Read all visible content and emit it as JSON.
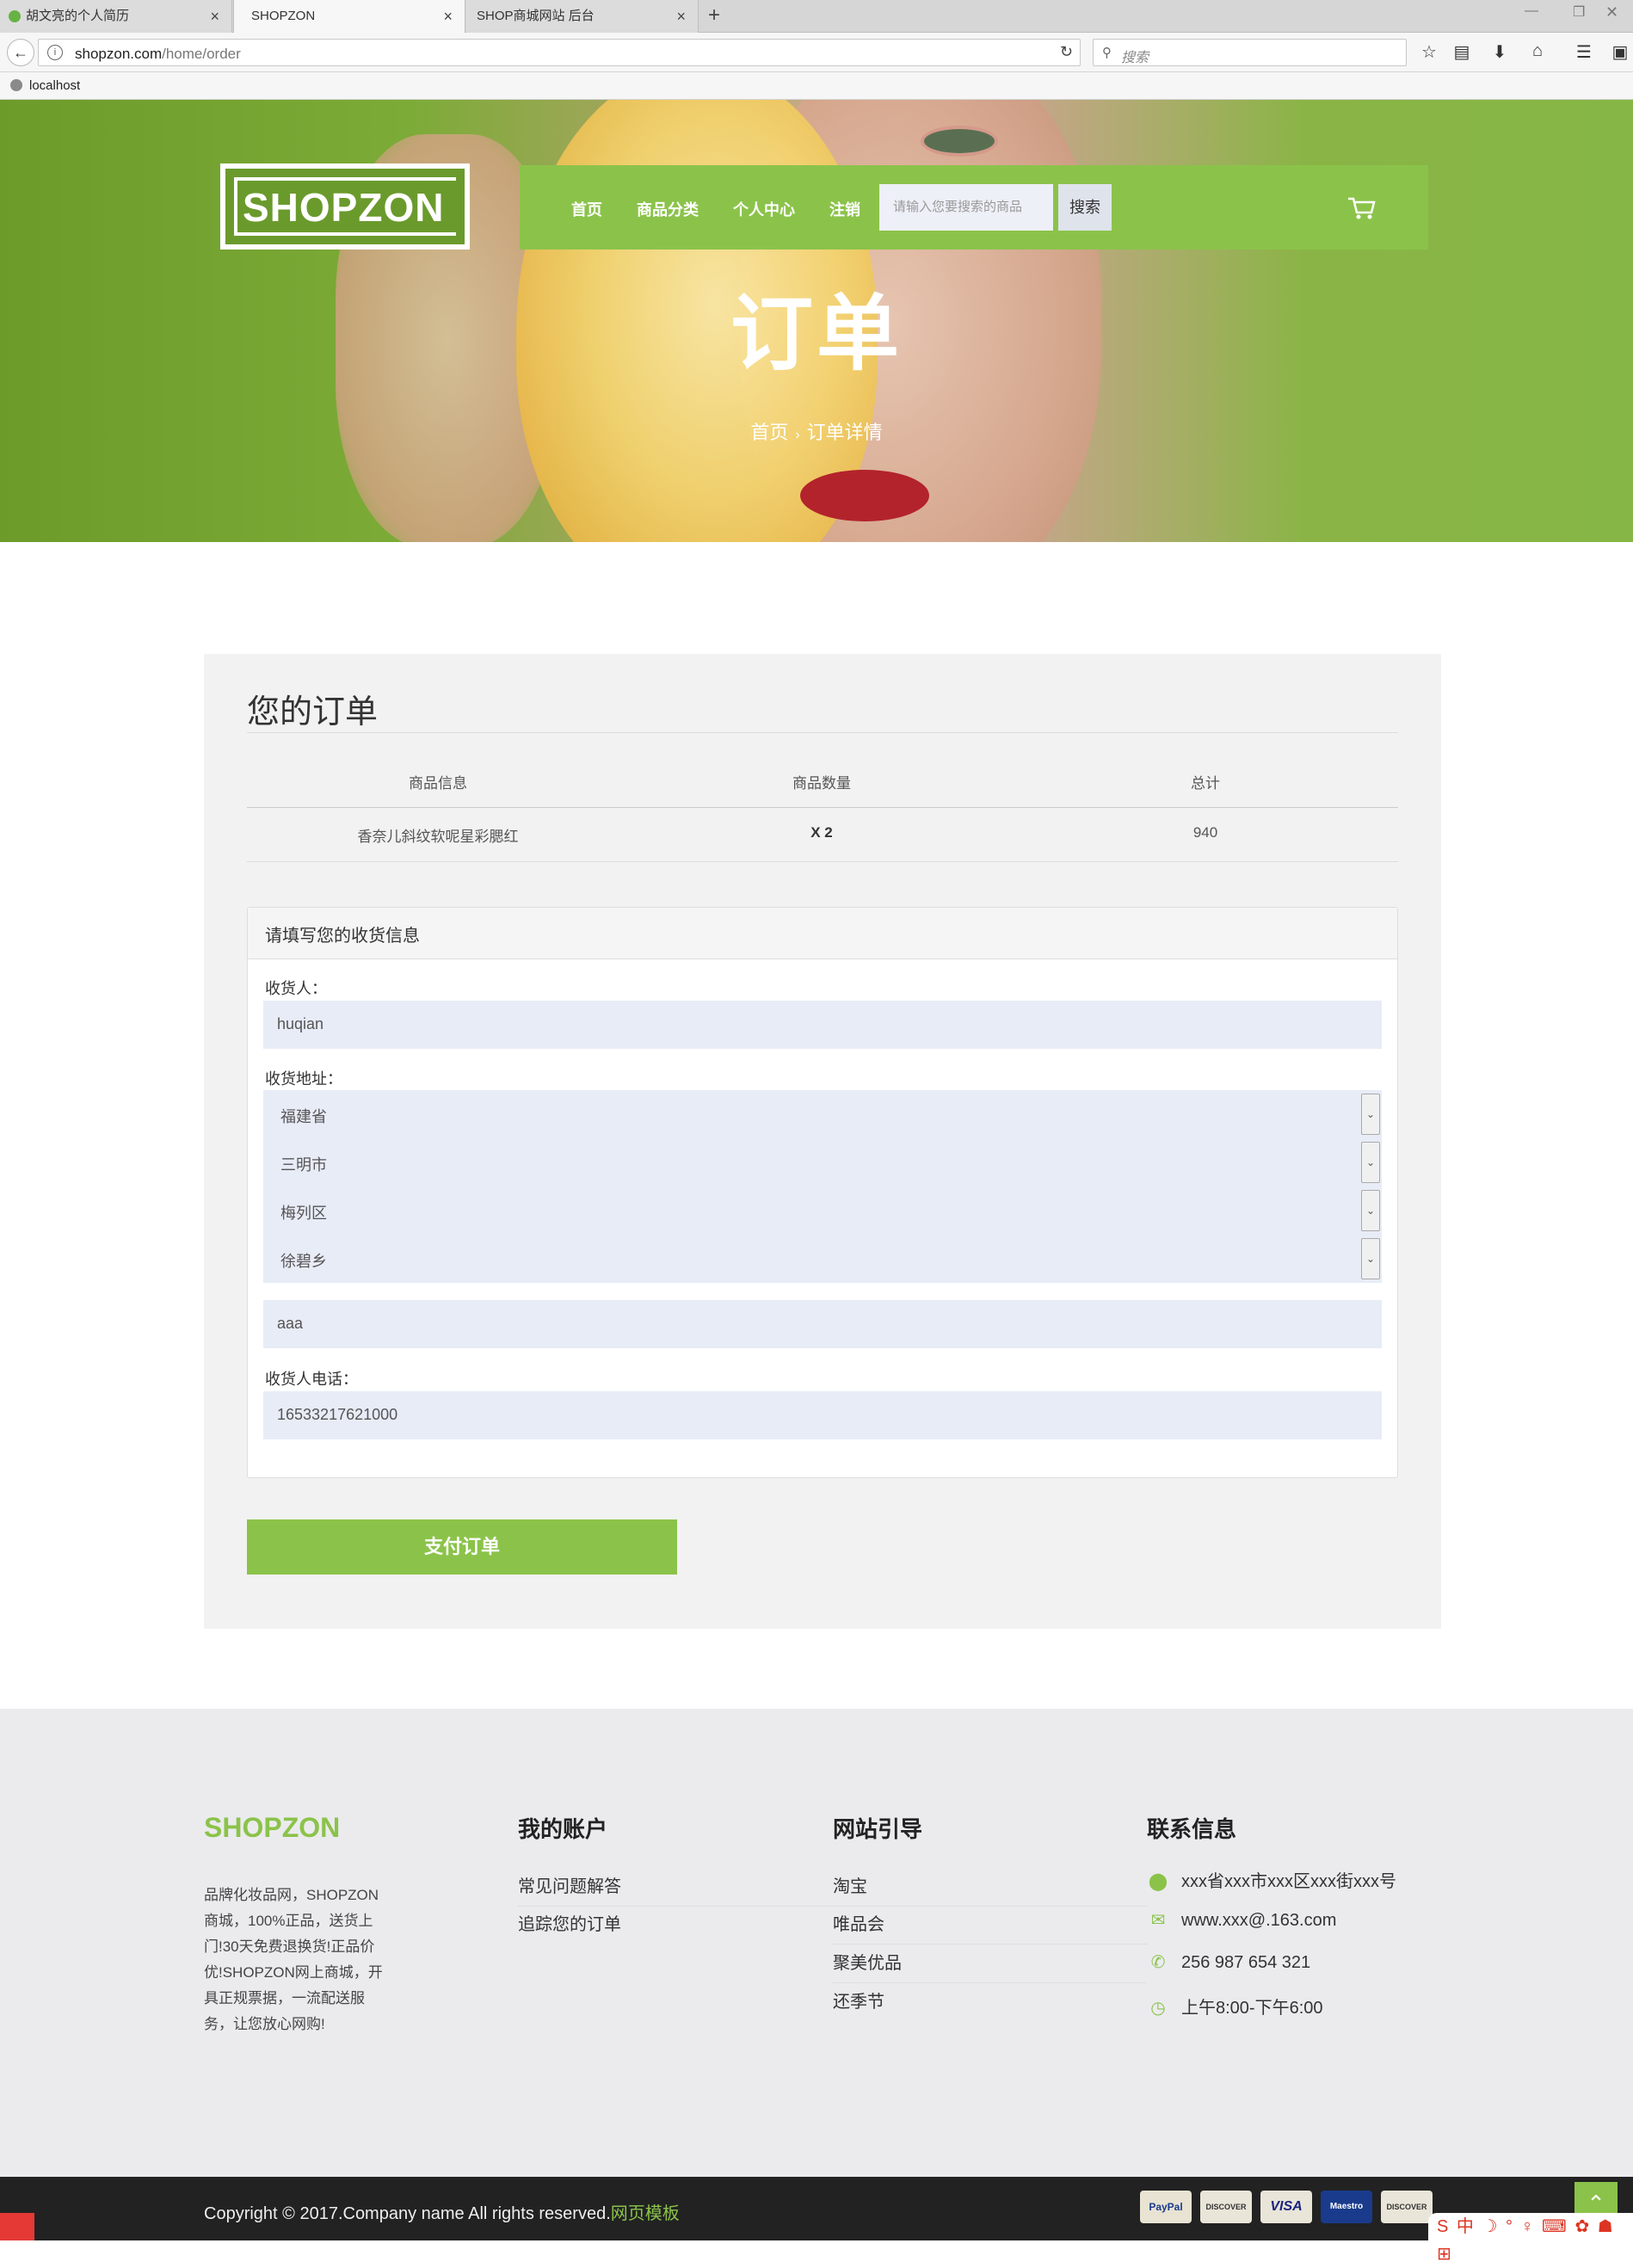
{
  "browser": {
    "tabs": [
      {
        "label": "胡文亮的个人简历"
      },
      {
        "label": "SHOPZON"
      },
      {
        "label": "SHOP商城网站 后台"
      }
    ],
    "url_host": "shopzon.com",
    "url_path": "/home/order",
    "search_placeholder": "搜索",
    "bookmark": "localhost"
  },
  "site": {
    "logo": "SHOPZON",
    "nav": {
      "home": "首页",
      "categories": "商品分类",
      "account": "个人中心",
      "logout": "注销",
      "search_placeholder": "请输入您要搜索的商品",
      "search_button": "搜索"
    },
    "hero_title": "订单",
    "breadcrumb": {
      "home": "首页",
      "current": "订单详情"
    }
  },
  "order": {
    "title": "您的订单",
    "headers": {
      "info": "商品信息",
      "qty": "商品数量",
      "total": "总计"
    },
    "row": {
      "name": "香奈儿斜纹软呢星彩腮红",
      "qty": "X 2",
      "total": "940"
    },
    "shipping": {
      "heading": "请填写您的收货信息",
      "receiver_label": "收货人：",
      "receiver_value": "huqian",
      "address_label": "收货地址：",
      "province": "福建省",
      "city": "三明市",
      "district": "梅列区",
      "town": "徐碧乡",
      "street_value": "aaa",
      "phone_label": "收货人电话：",
      "phone_value": "16533217621000"
    },
    "pay_button": "支付订单"
  },
  "footer": {
    "brand": "SHOPZON",
    "description": "品牌化妆品网，SHOPZON商城，100%正品，送货上门!30天免费退换货!正品价优!SHOPZON网上商城，开具正规票据，一流配送服务，让您放心网购!",
    "account_title": "我的账户",
    "account_links": [
      "常见问题解答",
      "追踪您的订单"
    ],
    "guide_title": "网站引导",
    "guide_links": [
      "淘宝",
      "唯品会",
      "聚美优品",
      "还季节"
    ],
    "contact_title": "联系信息",
    "address": "xxx省xxx市xxx区xxx街xxx号",
    "email": "www.xxx@.163.com",
    "phone": "256 987 654 321",
    "hours": "上午8:00-下午6:00",
    "copyright": "Copyright © 2017.Company name All rights reserved.",
    "copyright_link": "网页模板",
    "cards": [
      "PayPal",
      "DISCOVER",
      "VISA",
      "Maestro",
      "DISCOVER"
    ]
  },
  "colors": {
    "accent": "#8bc34a",
    "footer_bg": "#ebebee",
    "panel_bg": "#f2f2f2",
    "input_bg": "#e8ecf7"
  }
}
